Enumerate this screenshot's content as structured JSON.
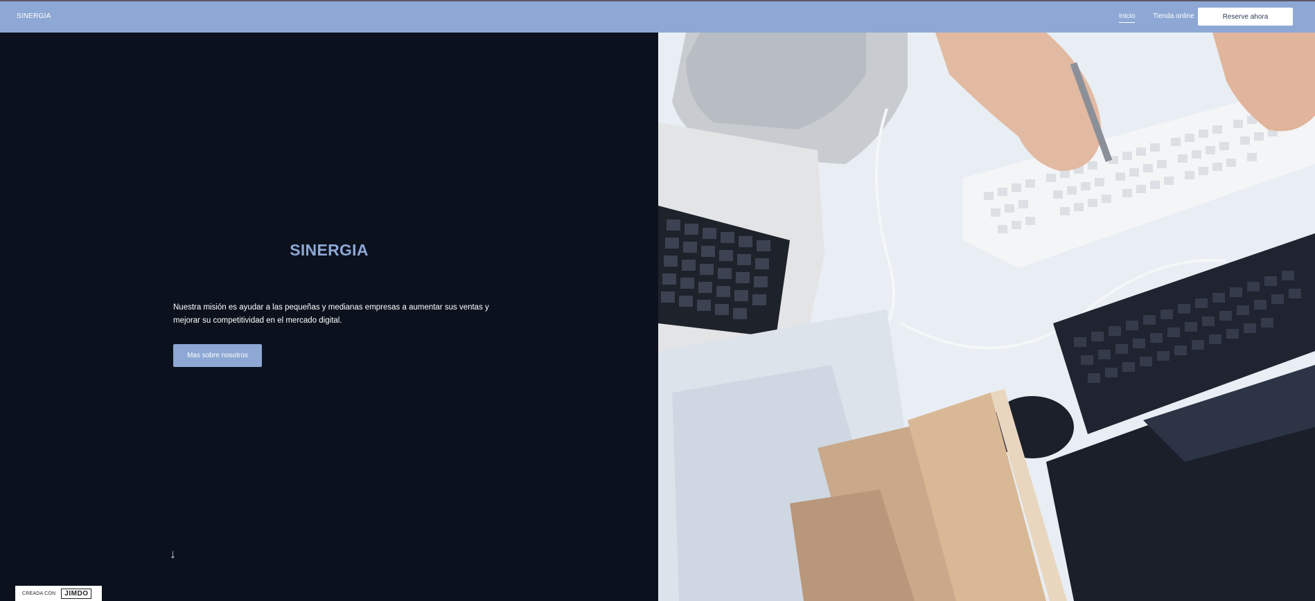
{
  "header": {
    "brand": "SINERGIA",
    "nav": [
      {
        "label": "Inicio",
        "active": true
      },
      {
        "label": "Tienda online",
        "active": false
      }
    ],
    "cta_label": "Reserve ahora"
  },
  "hero": {
    "title": "SINERGIA",
    "text": "Nuestra misión es ayudar a las pequeñas y medianas empresas a aumentar sus ventas y mejorar su competitividad en el mercado digital.",
    "button_label": "Mas sobre nosotros",
    "scroll_icon": "arrow-down-icon"
  },
  "footer_badge": {
    "prefix": "CREADA CON",
    "logo": "JIMDO"
  },
  "colors": {
    "accent": "#8ea8d5",
    "dark_bg": "#0b111d"
  }
}
